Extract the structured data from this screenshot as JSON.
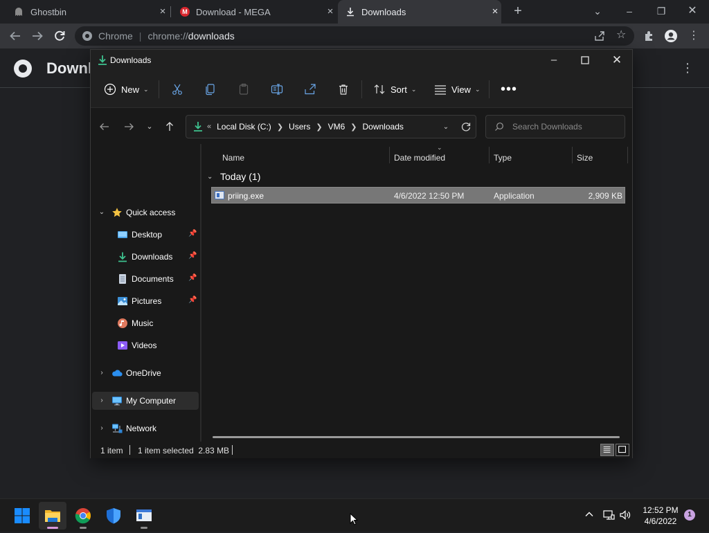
{
  "chrome": {
    "tabs": [
      {
        "title": "Ghostbin"
      },
      {
        "title": "Download - MEGA"
      },
      {
        "title": "Downloads"
      }
    ],
    "omnibox": {
      "label": "Chrome",
      "scheme": "chrome://",
      "host": "downloads"
    },
    "page_title": "Downl"
  },
  "explorer": {
    "title": "Downloads",
    "commands": {
      "new": "New",
      "sort": "Sort",
      "view": "View"
    },
    "breadcrumb": {
      "prefix": "«",
      "items": [
        "Local Disk (C:)",
        "Users",
        "VM6",
        "Downloads"
      ]
    },
    "search_placeholder": "Search Downloads",
    "nav": {
      "quick_access": "Quick access",
      "desktop": "Desktop",
      "downloads": "Downloads",
      "documents": "Documents",
      "pictures": "Pictures",
      "music": "Music",
      "videos": "Videos",
      "onedrive": "OneDrive",
      "my_computer": "My Computer",
      "network": "Network"
    },
    "columns": [
      "Name",
      "Date modified",
      "Type",
      "Size"
    ],
    "group": "Today (1)",
    "files": [
      {
        "name": "priing.exe",
        "date": "4/6/2022 12:50 PM",
        "type": "Application",
        "size": "2,909 KB"
      }
    ],
    "status": {
      "count": "1 item",
      "selected": "1 item selected  2.83 MB"
    }
  },
  "taskbar": {
    "time": "12:52 PM",
    "date": "4/6/2022",
    "notifications": "1"
  },
  "colors": {
    "accent_green": "#3ec28f",
    "windows_blue": "#1a8cff"
  }
}
